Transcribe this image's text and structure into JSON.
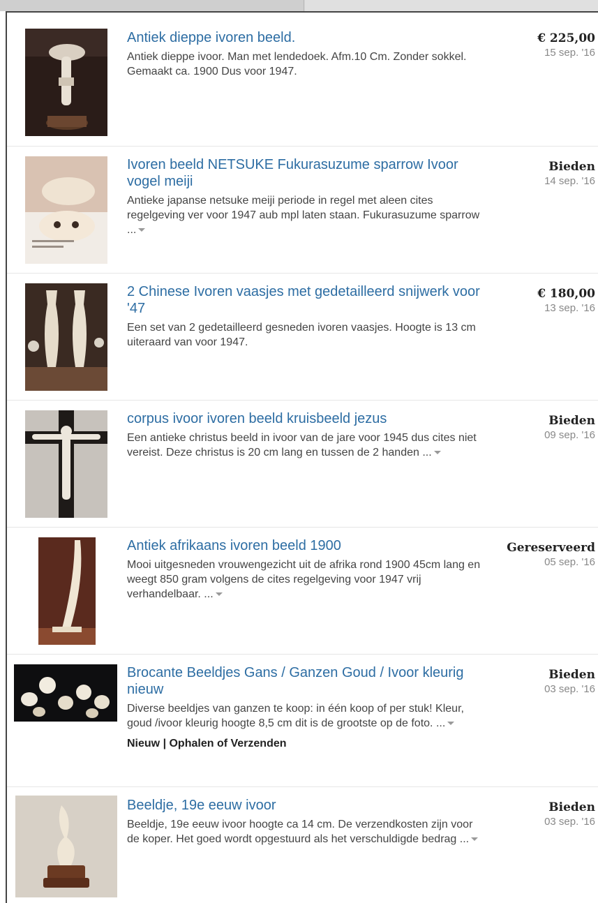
{
  "listings": [
    {
      "title": "Antiek dieppe ivoren beeld.",
      "description": "Antiek dieppe ivoor. Man met lendedoek. Afm.10 Cm. Zonder sokkel. Gemaakt ca. 1900 Dus voor 1947.",
      "more": "",
      "price": "€ 225,00",
      "date": "15 sep. '16",
      "attributes": "",
      "thumb_icon": "ivory-figure-photo"
    },
    {
      "title": "Ivoren beeld NETSUKE Fukurasuzume sparrow Ivoor vogel meiji",
      "description": "Antieke japanse netsuke meiji periode in regel met aleen cites regelgeving ver voor 1947 aub mpl laten staan. Fukurasuzume sparrow ...",
      "more": "yes",
      "price": "Bieden",
      "date": "14 sep. '16",
      "attributes": "",
      "thumb_icon": "netsuke-photo"
    },
    {
      "title": "2 Chinese Ivoren vaasjes met gedetailleerd snijwerk voor '47",
      "description": "Een set van 2 gedetailleerd gesneden ivoren vaasjes. Hoogte is 13 cm uiteraard van voor 1947.",
      "more": "",
      "price": "€ 180,00",
      "date": "13 sep. '16",
      "attributes": "",
      "thumb_icon": "vases-photo"
    },
    {
      "title": "corpus ivoor ivoren beeld kruisbeeld jezus",
      "description": "Een antieke christus beeld in ivoor van de jare voor 1945 dus cites niet vereist. Deze christus is 20 cm lang en tussen de 2 handen ...",
      "more": "yes",
      "price": "Bieden",
      "date": "09 sep. '16",
      "attributes": "",
      "thumb_icon": "crucifix-photo"
    },
    {
      "title": "Antiek afrikaans ivoren beeld 1900",
      "description": "Mooi uitgesneden vrouwengezicht uit de afrika rond 1900 45cm lang en weegt 850 gram volgens de cites regelgeving voor 1947 vrij verhandelbaar. ...",
      "more": "yes",
      "price": "Gereserveerd",
      "date": "05 sep. '16",
      "attributes": "",
      "thumb_icon": "tusk-photo"
    },
    {
      "title": "Brocante Beeldjes Gans / Ganzen Goud / Ivoor kleurig nieuw",
      "description": "Diverse beeldjes van ganzen te koop: in één koop of per stuk! Kleur, goud /ivoor kleurig hoogte 8,5 cm dit is de grootste op de foto. ...",
      "more": "yes",
      "price": "Bieden",
      "date": "03 sep. '16",
      "attributes": "Nieuw | Ophalen of Verzenden",
      "thumb_icon": "geese-photo"
    },
    {
      "title": "Beeldje, 19e eeuw ivoor",
      "description": "Beeldje, 19e eeuw ivoor hoogte ca 14 cm. De verzendkosten zijn voor de koper. Het goed wordt opgestuurd als het verschuldigde bedrag ...",
      "more": "yes",
      "price": "Bieden",
      "date": "03 sep. '16",
      "attributes": "",
      "thumb_icon": "statuette-photo"
    }
  ],
  "colors": {
    "title_link": "#2d6da3",
    "text": "#444444",
    "date": "#888888"
  }
}
